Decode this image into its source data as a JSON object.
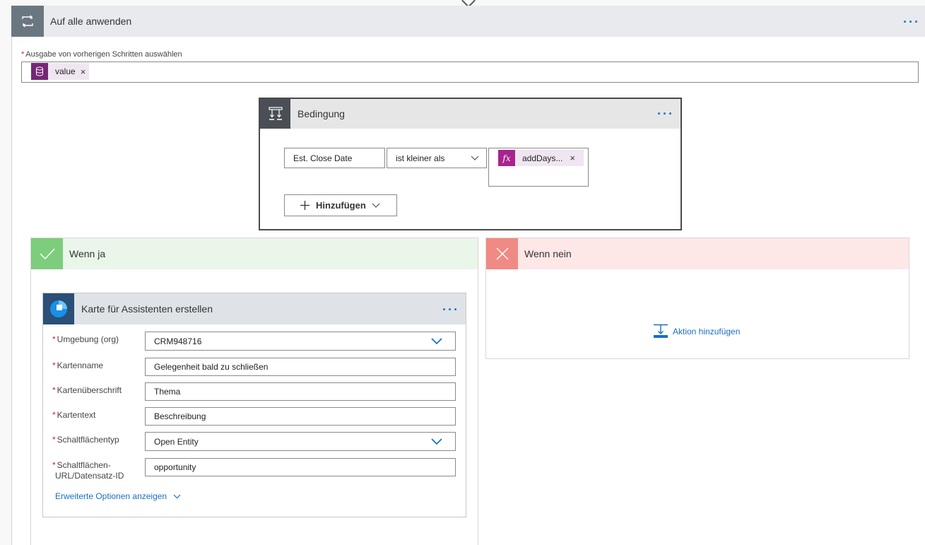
{
  "outer": {
    "title": "Auf alle anwenden",
    "menu": "···",
    "icon": "loop-icon",
    "output_label": "Ausgabe von vorherigen Schritten auswählen",
    "required_mark": "*",
    "token": {
      "label": "value",
      "icon": "database-icon",
      "remove": "×"
    }
  },
  "condition": {
    "title": "Bedingung",
    "menu": "···",
    "icon": "condition-icon",
    "left_operand": "Est. Close Date",
    "operator": "ist kleiner als",
    "right_token": {
      "label": "addDays...",
      "icon": "fx-icon",
      "icon_text": "fx",
      "remove": "×"
    },
    "add_button": "Hinzufügen"
  },
  "yes_branch": {
    "title": "Wenn ja",
    "card": {
      "title": "Karte für Assistenten erstellen",
      "menu": "···",
      "fields": [
        {
          "label": "Umgebung (org)",
          "value": "CRM948716",
          "type": "dropdown"
        },
        {
          "label": "Kartenname",
          "value": "Gelegenheit bald zu schließen",
          "type": "text"
        },
        {
          "label": "Kartenüberschrift",
          "value": "Thema",
          "type": "text"
        },
        {
          "label": "Kartentext",
          "value": "Beschreibung",
          "type": "text"
        },
        {
          "label": "Schaltflächentyp",
          "value": "Open Entity",
          "type": "dropdown"
        },
        {
          "label_line1": "Schaltflächen-",
          "label_line2": "URL/Datensatz-ID",
          "value": "opportunity",
          "type": "text"
        }
      ],
      "advanced_link": "Erweiterte Optionen anzeigen"
    }
  },
  "no_branch": {
    "title": "Wenn nein",
    "add_action": "Aktion hinzufügen"
  },
  "colors": {
    "accent": "#1a6fc2",
    "yes": "#7ccd7c",
    "no": "#f08a84",
    "token": "#742774",
    "required": "#c4262e"
  }
}
